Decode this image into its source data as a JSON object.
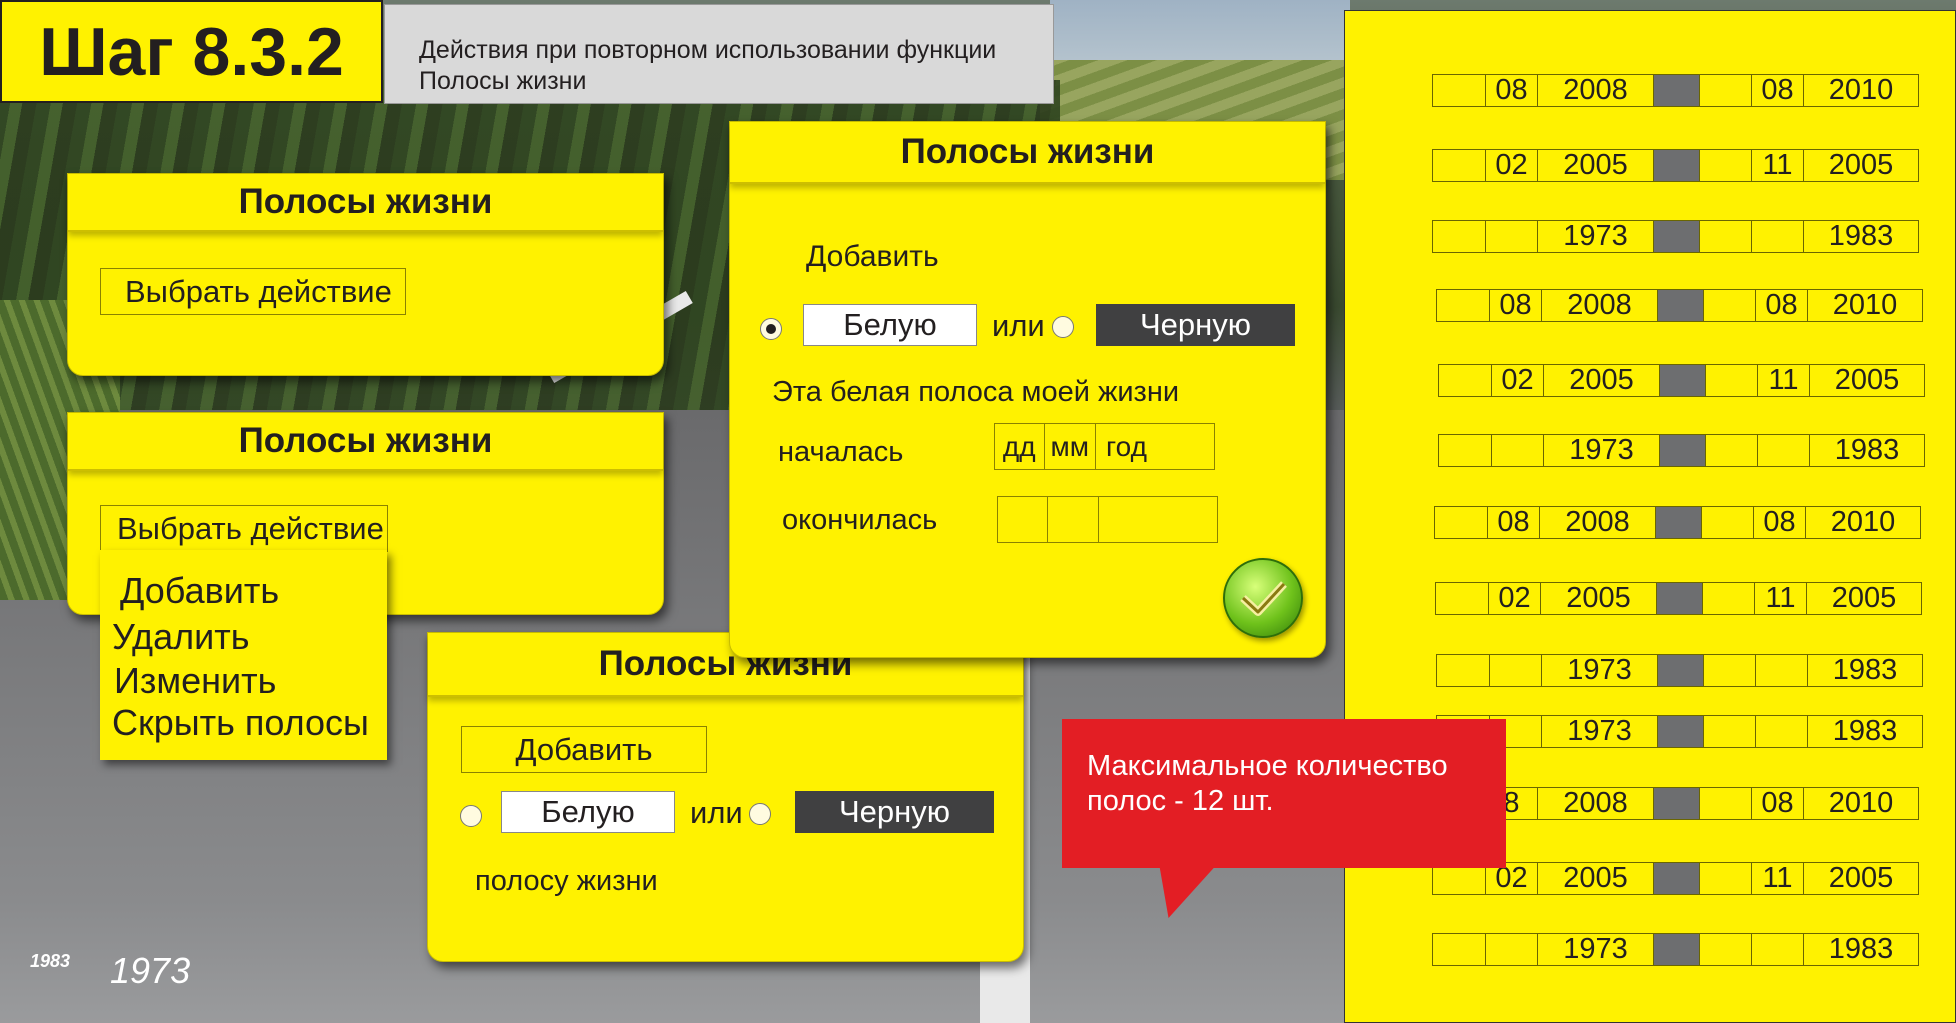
{
  "header": {
    "step": "Шаг 8.3.2",
    "description_line1": "Действия при повторном использовании функции",
    "description_line2": "Полосы жизни"
  },
  "panel1": {
    "title": "Полосы жизни",
    "select_label": "Выбрать действие"
  },
  "panel2": {
    "title": "Полосы жизни",
    "select_label": "Выбрать действие",
    "menu": [
      "Добавить",
      "Удалить",
      "Изменить",
      "Скрыть полосы"
    ]
  },
  "panel3": {
    "title": "Полосы жизни",
    "add_label": "Добавить",
    "white_label": "Белую",
    "or_label": "или",
    "black_label": "Черную",
    "suffix": "полосу жизни"
  },
  "panel4": {
    "title": "Полосы жизни",
    "add_label": "Добавить",
    "white_label": "Белую",
    "or_label": "или",
    "black_label": "Черную",
    "statement": "Эта белая полоса моей жизни",
    "started_label": "началась",
    "ended_label": "окончилась",
    "day_ph": "дд",
    "month_ph": "мм",
    "year_ph": "год",
    "selected": "white"
  },
  "stripes": [
    {
      "m1": "08",
      "y1": "2008",
      "m2": "08",
      "y2": "2010"
    },
    {
      "m1": "02",
      "y1": "2005",
      "m2": "11",
      "y2": "2005"
    },
    {
      "m1": "",
      "y1": "1973",
      "m2": "",
      "y2": "1983"
    },
    {
      "m1": "08",
      "y1": "2008",
      "m2": "08",
      "y2": "2010"
    },
    {
      "m1": "02",
      "y1": "2005",
      "m2": "11",
      "y2": "2005"
    },
    {
      "m1": "",
      "y1": "1973",
      "m2": "",
      "y2": "1983"
    },
    {
      "m1": "08",
      "y1": "2008",
      "m2": "08",
      "y2": "2010"
    },
    {
      "m1": "02",
      "y1": "2005",
      "m2": "11",
      "y2": "2005"
    },
    {
      "m1": "",
      "y1": "1973",
      "m2": "",
      "y2": "1983"
    },
    {
      "m1": "",
      "y1": "1973",
      "m2": "",
      "y2": "1983"
    },
    {
      "m1": "8",
      "y1": "2008",
      "m2": "08",
      "y2": "2010"
    },
    {
      "m1": "02",
      "y1": "2005",
      "m2": "11",
      "y2": "2005"
    },
    {
      "m1": "",
      "y1": "1973",
      "m2": "",
      "y2": "1983"
    }
  ],
  "tooltip": {
    "line1": "Максимальное количество",
    "line2": "полос - 12 шт."
  },
  "footer": {
    "small_year": "1983",
    "big_year": "1973"
  },
  "colors": {
    "panel": "#fff200",
    "dark": "#404041",
    "alert": "#e31e24"
  }
}
